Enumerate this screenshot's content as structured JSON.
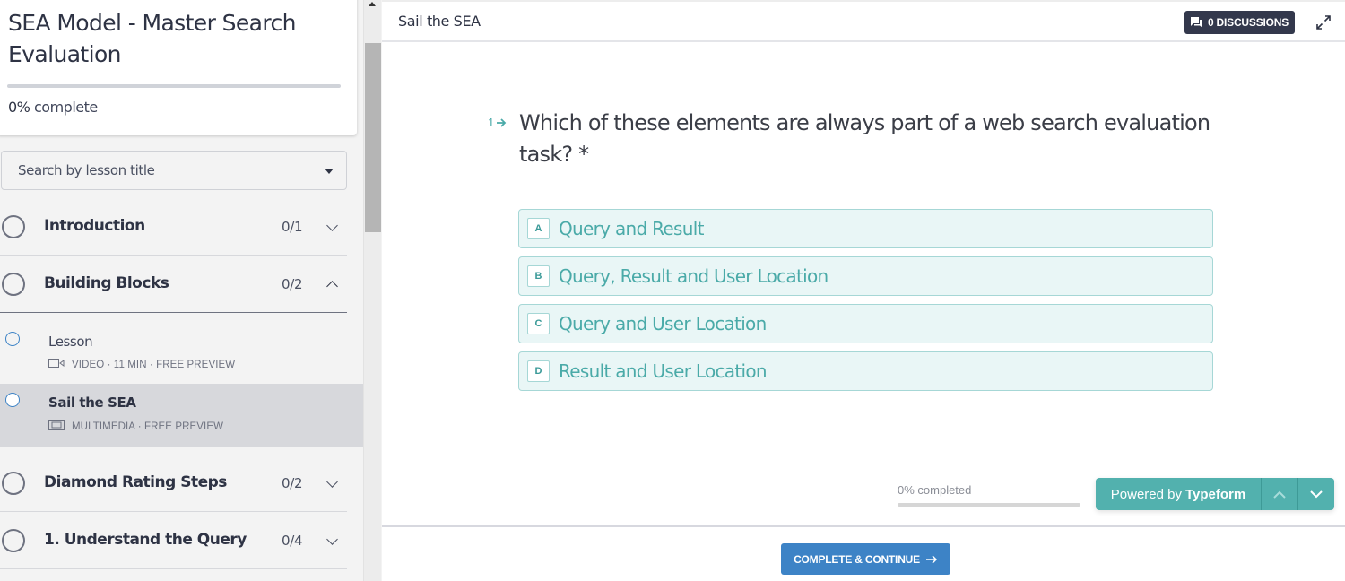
{
  "sidebar": {
    "course_title": "SEA Model - Master Search Evaluation",
    "progress_percent": 0,
    "progress_value": "0%",
    "progress_suffix": "complete",
    "search_placeholder": "Search by lesson title",
    "sections": [
      {
        "title": "Introduction",
        "count": "0/1",
        "expanded": false
      },
      {
        "title": "Building Blocks",
        "count": "0/2",
        "expanded": true
      },
      {
        "title": "Diamond Rating Steps",
        "count": "0/2",
        "expanded": false
      },
      {
        "title": "1. Understand the Query",
        "count": "0/4",
        "expanded": false
      }
    ],
    "lessons": [
      {
        "title": "Lesson",
        "icon": "video-icon",
        "meta": "VIDEO · 11 MIN ·  FREE PREVIEW",
        "active": false
      },
      {
        "title": "Sail the SEA",
        "icon": "multimedia-icon",
        "meta": "MULTIMEDIA ·  FREE PREVIEW",
        "active": true
      }
    ]
  },
  "header": {
    "lesson_title": "Sail the SEA",
    "discussions_label": "0 DISCUSSIONS",
    "discussions_icon": "chat-icon",
    "expand_icon": "expand-icon"
  },
  "typeform": {
    "question_number": "1",
    "question_text": "Which of these elements are always part of a web search evaluation task? *",
    "choices": [
      {
        "key": "A",
        "label": "Query and Result"
      },
      {
        "key": "B",
        "label": "Query, Result and User Location"
      },
      {
        "key": "C",
        "label": "Query and User Location"
      },
      {
        "key": "D",
        "label": "Result and User Location"
      }
    ],
    "progress_label": "0% completed",
    "progress_percent": 0,
    "powered_by_prefix": "Powered by",
    "powered_by_brand": "Typeform",
    "accent_color": "#52b1ae"
  },
  "footer": {
    "complete_label": "COMPLETE & CONTINUE",
    "accent_color": "#3d83c6"
  }
}
